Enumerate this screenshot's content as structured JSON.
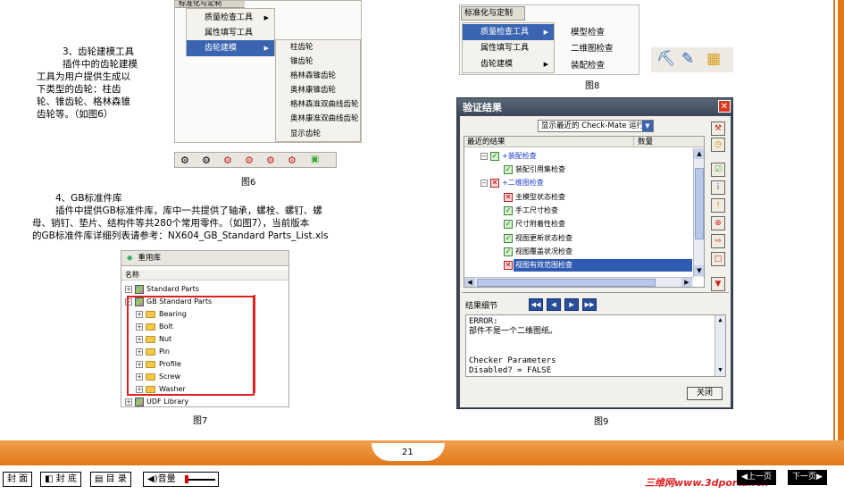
{
  "menu6": {
    "top_label": "标准化与定制",
    "items": [
      "质量检查工具",
      "属性填写工具",
      "齿轮建模"
    ],
    "submenu": [
      "柱齿轮",
      "锥齿轮",
      "格林森锥齿轮",
      "奥林康锥齿轮",
      "格林森准双曲线齿轮",
      "奥林康准双曲线齿轮",
      "显示齿轮"
    ]
  },
  "fig6_caption": "图6",
  "section3": {
    "lines": [
      "3、齿轮建模工具",
      "插件中的齿轮建模",
      "工具为用户提供生成以",
      "下类型的齿轮：柱齿",
      "轮、锥齿轮、格林森锥",
      "齿轮等。（如图6）"
    ]
  },
  "section4": {
    "title": "4、GB标准件库",
    "lines": [
      "插件中提供GB标准件库，库中一共提供了轴承，螺栓、螺钉、螺",
      "母、销钉、垫片、结构件等共280个常用零件。（如图7），当前版本",
      "的GB标准件库详细列表请参考：NX604_GB_Standard Parts_List.xls"
    ]
  },
  "fig7": {
    "header": "重用库",
    "column": "名称",
    "rows": [
      "Standard Parts",
      "GB Standard Parts",
      "Bearing",
      "Bolt",
      "Nut",
      "Pin",
      "Profile",
      "Screw",
      "Washer",
      "UDF Library"
    ],
    "caption": "图7"
  },
  "menu8": {
    "top_label": "标准化与定制",
    "items": [
      "质量检查工具",
      "属性填写工具",
      "齿轮建模"
    ],
    "submenu": [
      "模型检查",
      "二维图检查",
      "装配检查"
    ],
    "caption": "图8"
  },
  "dialog9": {
    "title": "验证结果",
    "dropdown": "显示最近的 Check-Mate 运行",
    "col_result": "最近的结果",
    "col_count": "数量",
    "tree": [
      "+装配检查",
      "装配引用集检查",
      "+二维图检查",
      "主模型状态检查",
      "手工尺寸检查",
      "尺寸附着性检查",
      "视图更新状态检查",
      "视图覆盖状况检查",
      "视图有效范围检查"
    ],
    "details_label": "结果细节",
    "details_text": [
      "ERROR:",
      "部件不是一个二维图纸。",
      "",
      "",
      "Checker Parameters",
      "Disabled? = FALSE"
    ],
    "close_label": "关闭",
    "caption": "图9"
  },
  "page_number": "21",
  "bottom_bar": {
    "buttons": [
      "封 面",
      "封 底",
      "目 录",
      "音量"
    ],
    "watermark": "三维网www.3dportal.cn",
    "nav": [
      "上一页",
      "下一页"
    ]
  },
  "colors": {
    "accent_orange": "#e8821e",
    "menu_select": "#3a64b0",
    "dialog_title": "#3e4a5a"
  }
}
